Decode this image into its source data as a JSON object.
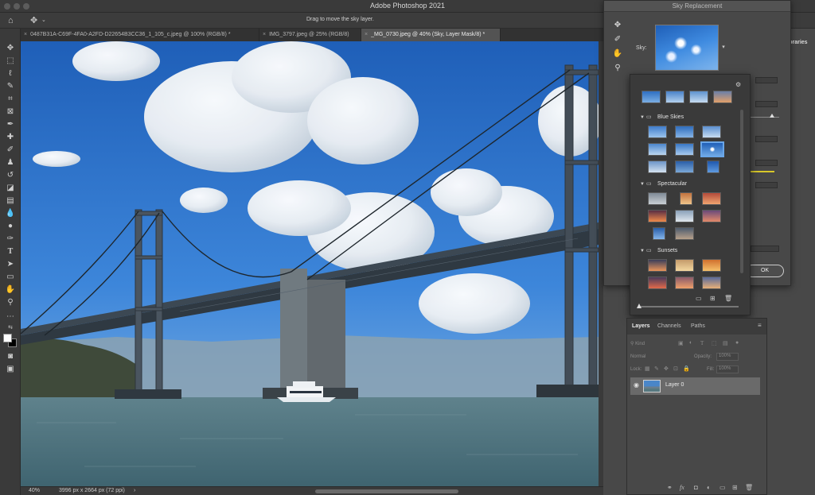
{
  "window": {
    "title": "Adobe Photoshop 2021"
  },
  "options_bar": {
    "hint": "Drag to move the sky layer."
  },
  "tabs": [
    {
      "label": "0487B31A-C69F-4FA0-A2FD-D22654B3CC36_1_105_c.jpeg @ 100% (RGB/8) *",
      "active": false
    },
    {
      "label": "IMG_3797.jpeg @ 25% (RGB/8)",
      "active": false
    },
    {
      "label": "_MG_0730.jpeg @ 40% (Sky, Layer Mask/8) *",
      "active": true
    }
  ],
  "tab_close_glyph": "×",
  "status_bar": {
    "zoom": "40%",
    "doc_info": "3996 px x 2664 px (72 ppi)"
  },
  "right_dock": {
    "libraries_label": "Libraries"
  },
  "sky_replacement": {
    "title": "Sky Replacement",
    "sky_label": "Sky:",
    "ok_label": "OK"
  },
  "sky_presets": {
    "folders": [
      {
        "name": "Blue Skies"
      },
      {
        "name": "Spectacular"
      },
      {
        "name": "Sunsets"
      }
    ]
  },
  "layers_panel": {
    "tabs": [
      {
        "label": "Layers",
        "active": true
      },
      {
        "label": "Channels",
        "active": false
      },
      {
        "label": "Paths",
        "active": false
      }
    ],
    "kind_label": "Kind",
    "blend_mode": "Normal",
    "opacity_label": "Opacity:",
    "opacity_value": "100%",
    "lock_label": "Lock:",
    "fill_label": "Fill:",
    "fill_value": "100%",
    "layers": [
      {
        "name": "Layer 0",
        "visible": true
      }
    ]
  },
  "colors": {
    "accent_blue": "#3f8be0",
    "panel_bg": "#484848",
    "chrome_bg": "#3a3a3a"
  }
}
